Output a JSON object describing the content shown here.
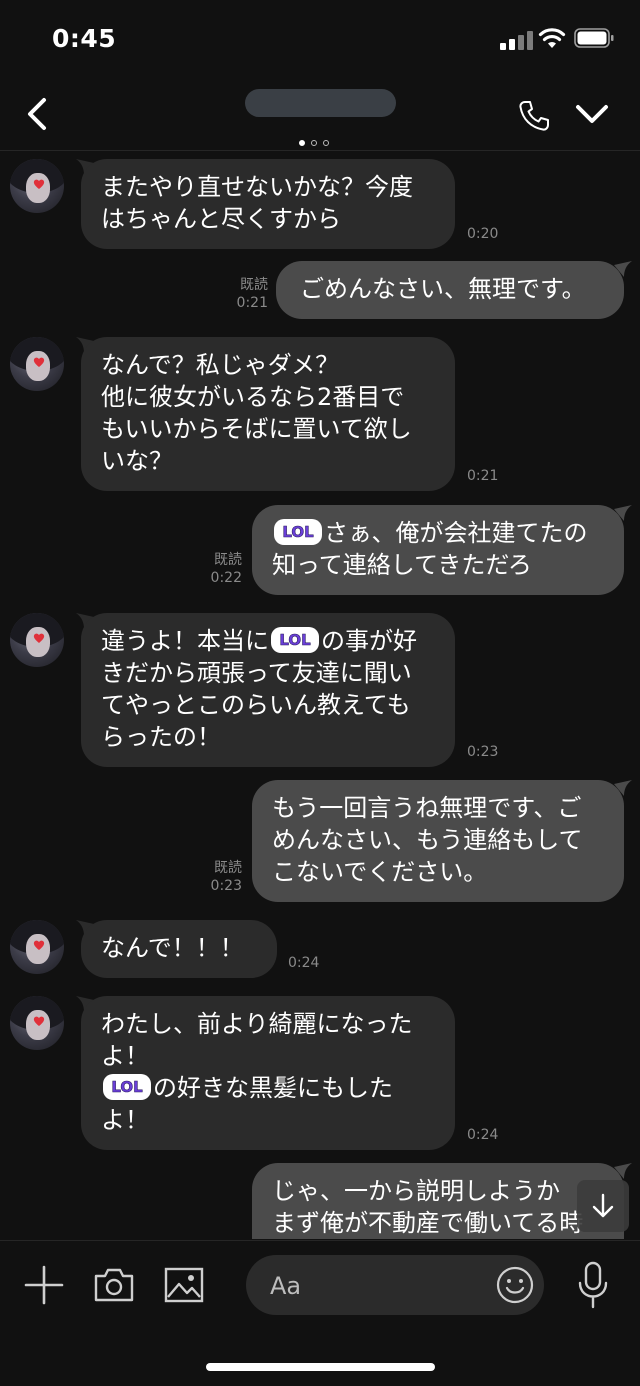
{
  "status_bar": {
    "time": "0:45",
    "signal": "signal-icon",
    "wifi": "wifi-icon",
    "battery": "battery-icon"
  },
  "header": {
    "page_indicator": {
      "count": 3,
      "active_index": 0
    }
  },
  "messages": [
    {
      "side": "in",
      "text": "またやり直せないかな？今度\nはちゃんと尽くすから",
      "time": "0:20"
    },
    {
      "side": "out",
      "text": "ごめんなさい、無理です。",
      "read": "既読",
      "time": "0:21"
    },
    {
      "side": "in",
      "text": "なんで？私じゃダメ？\n他に彼女がいるなら2番目で\nもいいからそばに置いて欲し\nいな？",
      "time": "0:21"
    },
    {
      "side": "out",
      "text_after_sticker": "さぁ、俺が会社建てたの\n知って連絡してきただろ",
      "sticker": "LOL",
      "read": "既読",
      "time": "0:22"
    },
    {
      "side": "in",
      "text_before_sticker": "違うよ！本当に",
      "sticker": "LOL",
      "text_after_sticker": "の事が好\nきだから頑張って友達に聞い\nてやっとこのらいん教えても\nらったの！",
      "time": "0:23"
    },
    {
      "side": "out",
      "text": "もう一回言うね無理です、ご\nめんなさい、もう連絡もして\nこないでください。",
      "read": "既読",
      "time": "0:23"
    },
    {
      "side": "in",
      "text": "なんで！！！",
      "time": "0:24"
    },
    {
      "side": "in",
      "text_before_sticker": "わたし、前より綺麗になった\nよ！\n",
      "sticker": "LOL",
      "text_after_sticker": "の好きな黒髪にもした\nよ！",
      "time": "0:24"
    },
    {
      "side": "out",
      "text": "じゃ、一から説明しようか\nまず俺が不動産で働いてる時"
    }
  ],
  "input": {
    "placeholder": "Aa"
  },
  "icons": {
    "back": "chevron-left-icon",
    "call": "phone-icon",
    "menu": "chevron-down-icon",
    "add": "plus-icon",
    "camera": "camera-icon",
    "image": "image-icon",
    "emoji": "emoji-icon",
    "mic": "microphone-icon",
    "scroll": "arrow-down-icon"
  }
}
